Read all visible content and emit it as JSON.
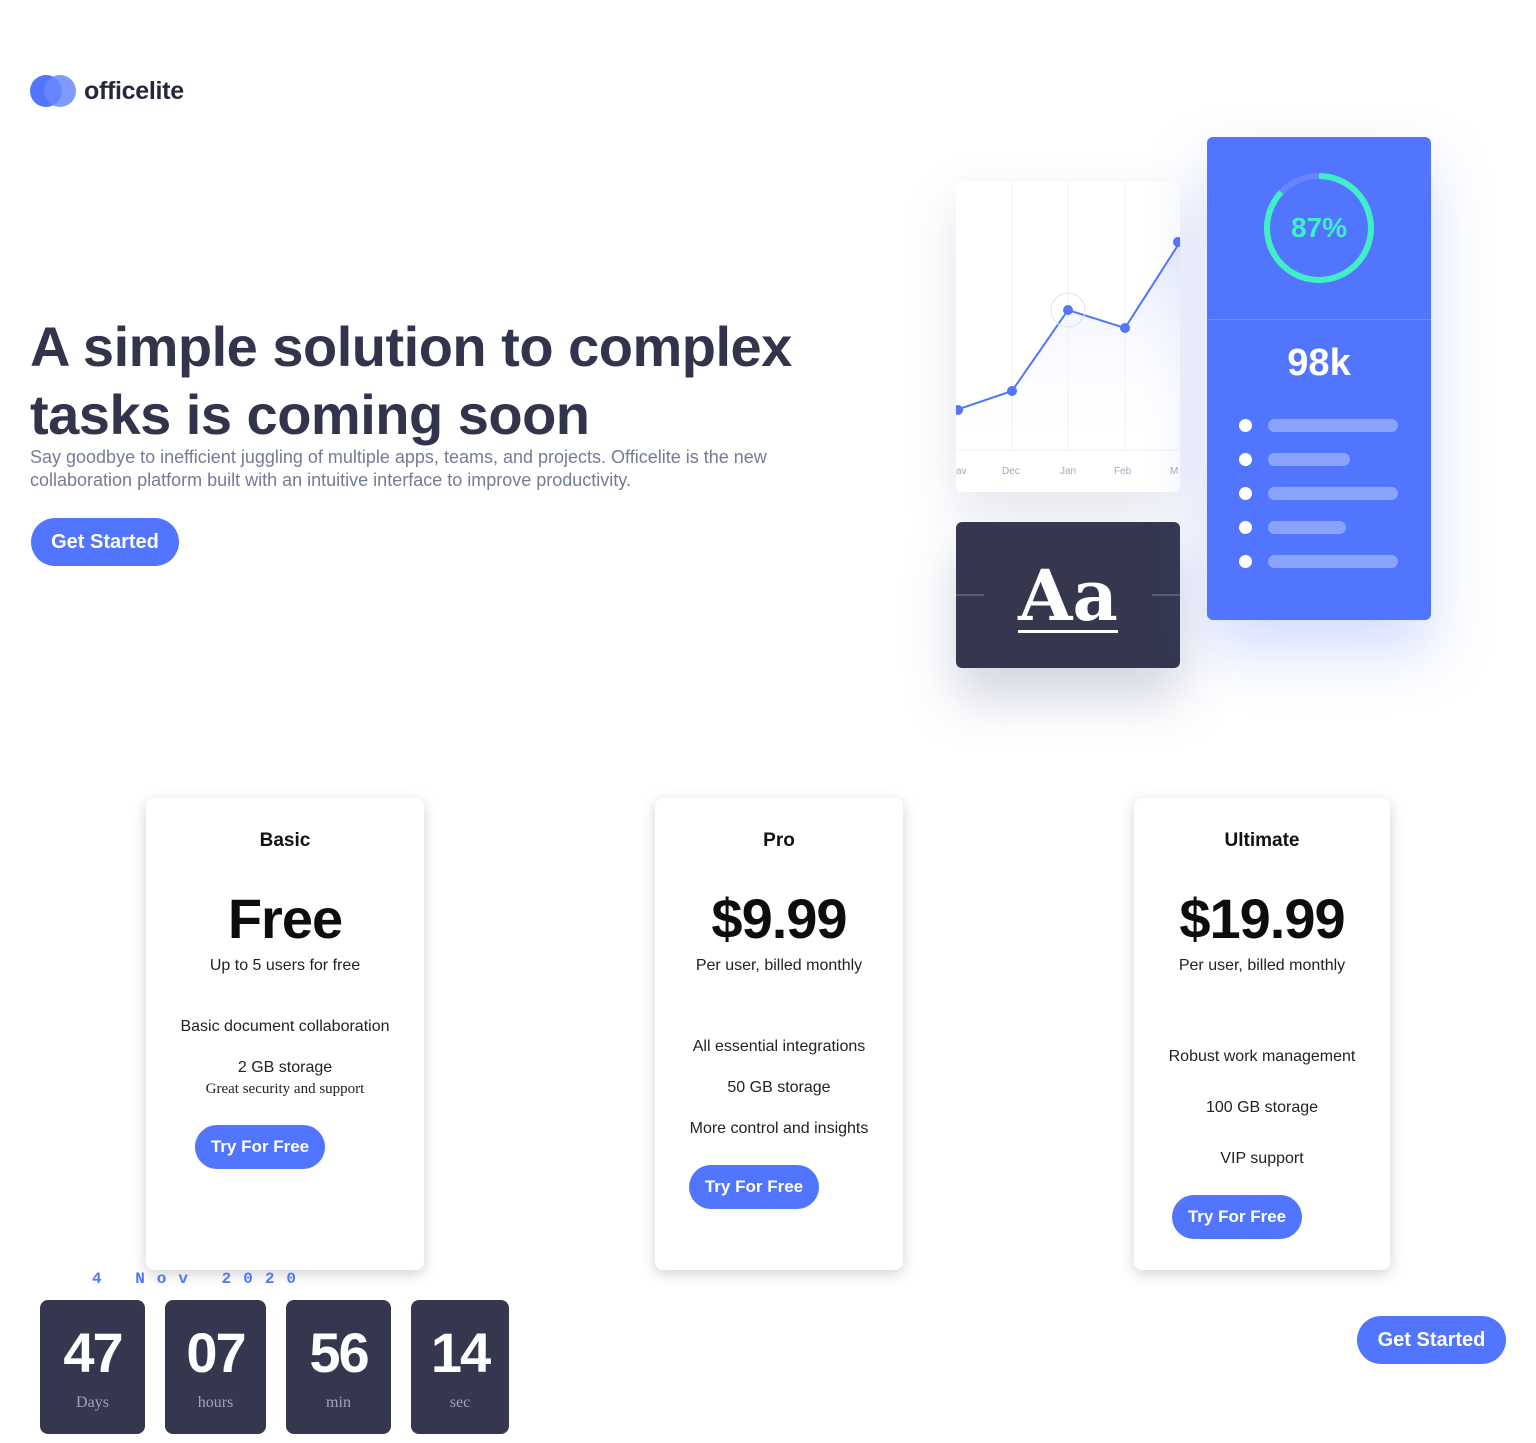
{
  "brand": {
    "name": "officelite"
  },
  "hero": {
    "title": "A simple solution to complex tasks is coming soon",
    "description": "Say goodbye to inefficient juggling of multiple apps, teams, and projects. Officelite is the new collaboration platform built with an intuitive interface to improve productivity.",
    "cta_label": "Get Started"
  },
  "illustration": {
    "chart_months": [
      "av",
      "Dec",
      "Jan",
      "Feb",
      "M"
    ],
    "font_sample": "Aa",
    "progress_percent": 87,
    "progress_label": "87%",
    "stat_value": "98k",
    "accent_color": "#5175ff",
    "ring_color": "#3ff0c5",
    "dark_color": "#35374f"
  },
  "plans": [
    {
      "name": "Basic",
      "price": "Free",
      "subtitle": "Up to 5 users for free",
      "features": [
        "Basic document collaboration",
        "2 GB storage",
        "Great security and support"
      ],
      "cta_label": "Try For Free"
    },
    {
      "name": "Pro",
      "price": "$9.99",
      "subtitle": "Per user, billed monthly",
      "features": [
        "All essential integrations",
        "50 GB storage",
        "More control and insights"
      ],
      "cta_label": "Try For Free"
    },
    {
      "name": "Ultimate",
      "price": "$19.99",
      "subtitle": "Per user, billed monthly",
      "features": [
        "Robust work management",
        "100 GB storage",
        "VIP support"
      ],
      "cta_label": "Try For Free"
    }
  ],
  "countdown": {
    "date": "4 Nov 2020",
    "units": [
      {
        "value": "47",
        "label": "Days"
      },
      {
        "value": "07",
        "label": "hours"
      },
      {
        "value": "56",
        "label": "min"
      },
      {
        "value": "14",
        "label": "sec"
      }
    ]
  },
  "footer": {
    "cta_label": "Get Started"
  }
}
